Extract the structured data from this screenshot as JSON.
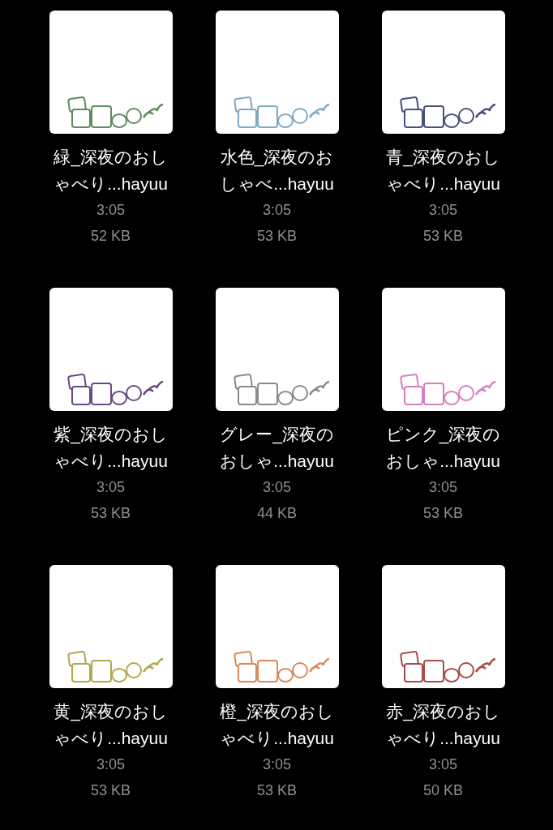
{
  "files": [
    {
      "name_line1": "緑_深夜のおし",
      "name_line2": "ゃべり...hayuu",
      "time": "3:05",
      "size": "52 KB",
      "color": "#5e8a5e"
    },
    {
      "name_line1": "水色_深夜のお",
      "name_line2": "しゃべ...hayuu",
      "time": "3:05",
      "size": "53 KB",
      "color": "#7fa9c2"
    },
    {
      "name_line1": "青_深夜のおし",
      "name_line2": "ゃべり...hayuu",
      "time": "3:05",
      "size": "53 KB",
      "color": "#4a4f7a"
    },
    {
      "name_line1": "紫_深夜のおし",
      "name_line2": "ゃべり...hayuu",
      "time": "3:05",
      "size": "53 KB",
      "color": "#6a4a86"
    },
    {
      "name_line1": "グレー_深夜の",
      "name_line2": "おしゃ...hayuu",
      "time": "3:05",
      "size": "44 KB",
      "color": "#8a8a8a"
    },
    {
      "name_line1": "ピンク_深夜の",
      "name_line2": "おしゃ...hayuu",
      "time": "3:05",
      "size": "53 KB",
      "color": "#d77fc4"
    },
    {
      "name_line1": "黄_深夜のおし",
      "name_line2": "ゃべり...hayuu",
      "time": "3:05",
      "size": "53 KB",
      "color": "#b3a84a"
    },
    {
      "name_line1": "橙_深夜のおし",
      "name_line2": "ゃべり...hayuu",
      "time": "3:05",
      "size": "53 KB",
      "color": "#d98a5a"
    },
    {
      "name_line1": "赤_深夜のおし",
      "name_line2": "ゃべり...hayuu",
      "time": "3:05",
      "size": "50 KB",
      "color": "#a84a4a"
    }
  ]
}
